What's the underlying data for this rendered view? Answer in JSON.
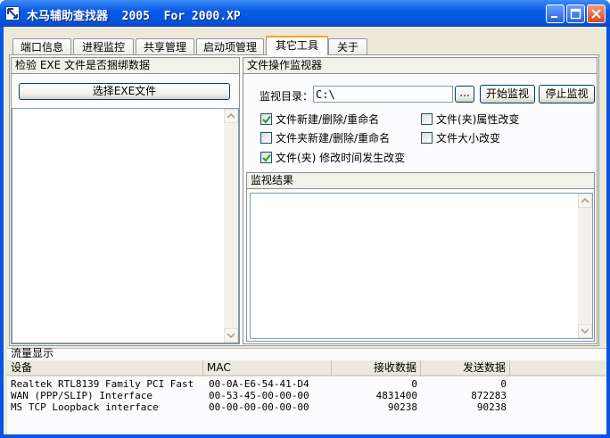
{
  "window": {
    "title": "木马辅助查找器  2005  For 2000.XP"
  },
  "tabs": [
    {
      "label": "端口信息",
      "active": false
    },
    {
      "label": "进程监控",
      "active": false
    },
    {
      "label": "共享管理",
      "active": false
    },
    {
      "label": "启动项管理",
      "active": false
    },
    {
      "label": "其它工具",
      "active": true
    },
    {
      "label": "关于",
      "active": false
    }
  ],
  "exe_check": {
    "title": "检验 EXE 文件是否捆绑数据",
    "select_button": "选择EXE文件"
  },
  "file_monitor": {
    "title": "文件操作监视器",
    "dir_label": "监视目录：",
    "dir_value": "C:\\",
    "browse_button": "...",
    "start_button": "开始监视",
    "stop_button": "停止监视",
    "options": [
      {
        "label": "文件新建/删除/重命名",
        "checked": true
      },
      {
        "label": "文件(夹)属性改变",
        "checked": false
      },
      {
        "label": "文件夹新建/删除/重命名",
        "checked": false
      },
      {
        "label": "文件大小改变",
        "checked": false
      },
      {
        "label": "文件(夹) 修改时间发生改变",
        "checked": true
      }
    ],
    "results_title": "监视结果"
  },
  "traffic": {
    "title": "流量显示",
    "columns": [
      "设备",
      "MAC",
      "接收数据",
      "发送数据"
    ],
    "rows": [
      [
        "Realtek RTL8139 Family PCI Fast ...",
        "00-0A-E6-54-41-D4",
        "0",
        "0"
      ],
      [
        "WAN (PPP/SLIP) Interface",
        "00-53-45-00-00-00",
        "4831400",
        "872283"
      ],
      [
        "MS TCP Loopback interface",
        "00-00-00-00-00-00",
        "90238",
        "90238"
      ]
    ]
  }
}
